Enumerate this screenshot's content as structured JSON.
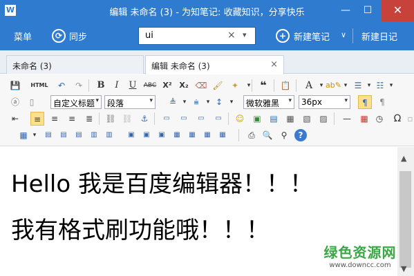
{
  "window": {
    "logo": "W",
    "title": "编辑 未命名 (3) - 为知笔记: 收藏知识，分享快乐",
    "minimize": "—",
    "maximize": "☐",
    "close": "✕"
  },
  "toolbar": {
    "menu": "菜单",
    "sync": "同步",
    "search_value": "ui",
    "search_clear": "×",
    "search_dropdown": "▾",
    "new_note": "新建笔记",
    "new_note_dropdown": "∨",
    "new_diary": "新建日记"
  },
  "tabs": [
    {
      "label": "未命名 (3)"
    },
    {
      "label": "编辑 未命名 (3)",
      "close": "×"
    }
  ],
  "editor_toolbar": {
    "html_label": "HTML",
    "bold": "B",
    "italic": "I",
    "underline": "U",
    "strike": "ABC",
    "superscript": "X²",
    "subscript": "X₂",
    "quote": "❝",
    "font_color": "A",
    "paragraph_style": "自定义标题",
    "block": "段落",
    "font_family": "微软雅黑",
    "font_size": "36px",
    "omega": "Ω",
    "help": "?"
  },
  "content": {
    "line1": "Hello 我是百度编辑器！！！",
    "line2": "我有格式刷功能哦！！！"
  },
  "watermark": {
    "cn": "绿色资源网",
    "url": "www.downcc.com"
  },
  "colors": {
    "accent": "#2f7bd0",
    "close": "#c7423b"
  }
}
